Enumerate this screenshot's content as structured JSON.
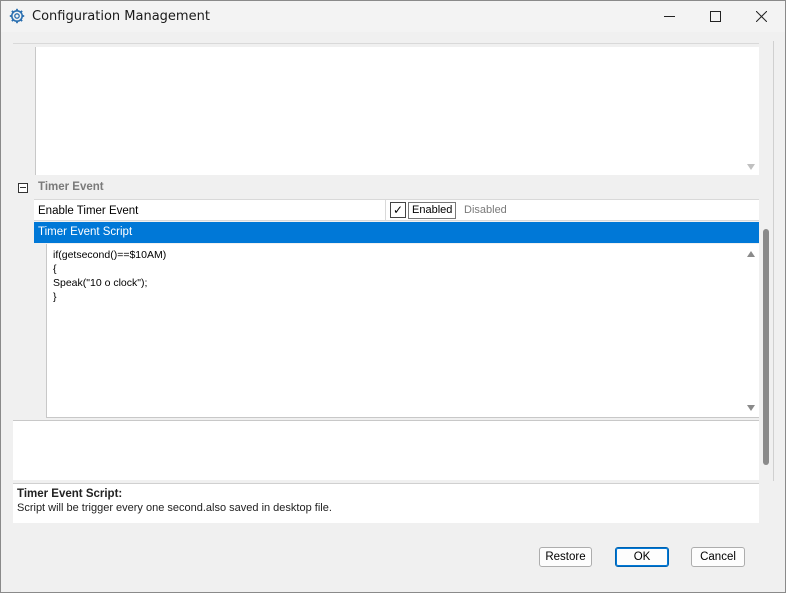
{
  "window": {
    "title": "Configuration Management",
    "icon": "gear-icon",
    "controls": [
      "minimize-icon",
      "maximize-icon",
      "close-icon"
    ]
  },
  "grid": {
    "category": {
      "label": "Timer Event",
      "expanded": true
    },
    "properties": [
      {
        "name": "Enable Timer Event",
        "checkbox_symbol": "✓",
        "options": {
          "enabled": "Enabled",
          "disabled": "Disabled",
          "selected": "Enabled"
        }
      }
    ],
    "selected_row": {
      "label": "Timer Event Script"
    },
    "script_lines": [
      "if(getsecond()==$10AM)",
      "{",
      "Speak(\"10 o clock\");",
      "}"
    ]
  },
  "description": {
    "title": "Timer Event Script:",
    "text": "Script will be trigger every one second.also saved in desktop file."
  },
  "buttons": {
    "restore": "Restore",
    "ok": "OK",
    "cancel": "Cancel"
  },
  "colors": {
    "selection": "#0078d7",
    "window_bg": "#f0f0f0"
  }
}
